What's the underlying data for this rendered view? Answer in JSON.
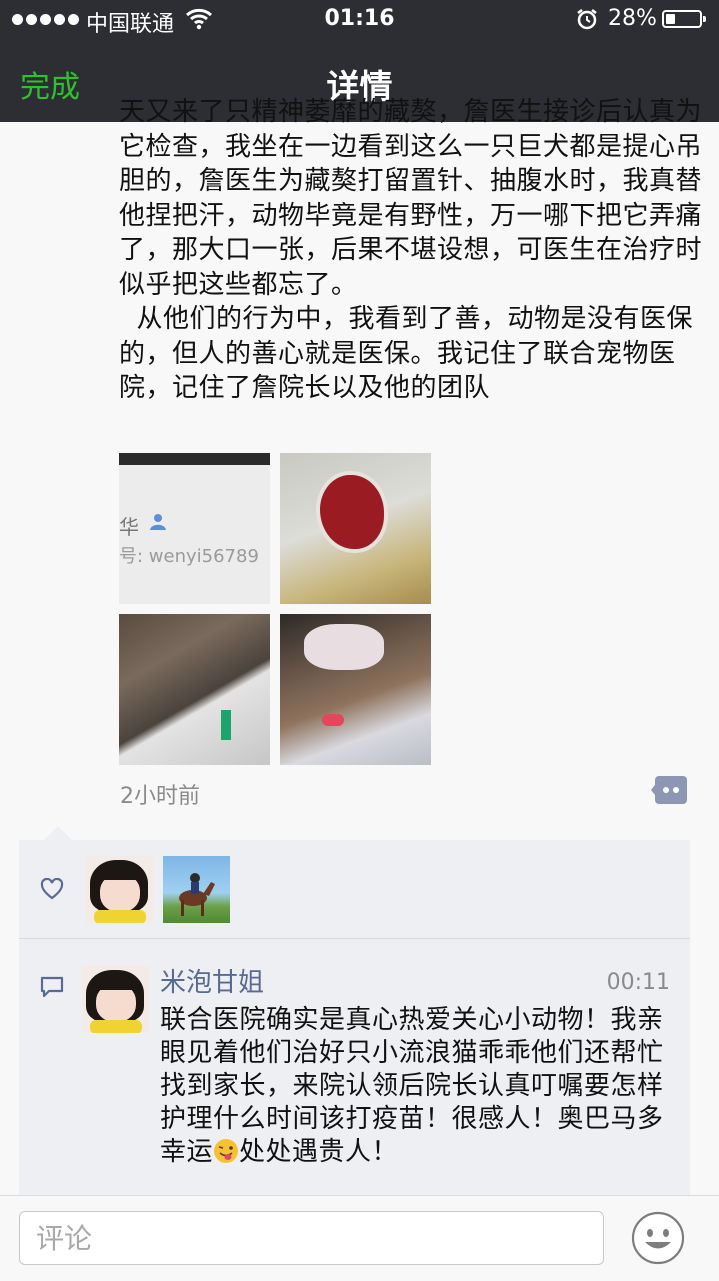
{
  "status_bar": {
    "carrier": "中国联通",
    "time": "01:16",
    "battery_percent_text": "28%",
    "battery_level": 0.28
  },
  "nav": {
    "done_label": "完成",
    "title": "详情"
  },
  "post": {
    "text": "天又来了只精神萎靡的藏獒，詹医生接诊后认真为它检查，我坐在一边看到这么一只巨犬都是提心吊胆的，詹医生为藏獒打留置针、抽腹水时，我真替他捏把汗，动物毕竟是有野性，万一哪下把它弄痛了，那大口一张，后果不堪设想，可医生在治疗时似乎把这些都忘了。\n  从他们的行为中，我看到了善，动物是没有医保的，但人的善心就是医保。我记住了联合宠物医院，记住了詹院长以及他的团队",
    "image1": {
      "name_fragment": "华",
      "id_fragment": "号: wenyi56789"
    },
    "time_ago": "2小时前"
  },
  "comments": [
    {
      "author": "米泡甘姐",
      "time": "00:11",
      "text_before_emoji": "联合医院确实是真心热爱关心小动物！我亲眼见着他们治好只小流浪猫乖乖他们还帮忙找到家长，来院认领后院长认真叮嘱要怎样护理什么时间该打疫苗！很感人！奥巴马多幸运",
      "text_after_emoji": "处处遇贵人！"
    }
  ],
  "input": {
    "placeholder": "评论"
  },
  "colors": {
    "nav_background": "#2d2e33",
    "done_green": "#2fc22f",
    "author_link": "#576b95"
  }
}
